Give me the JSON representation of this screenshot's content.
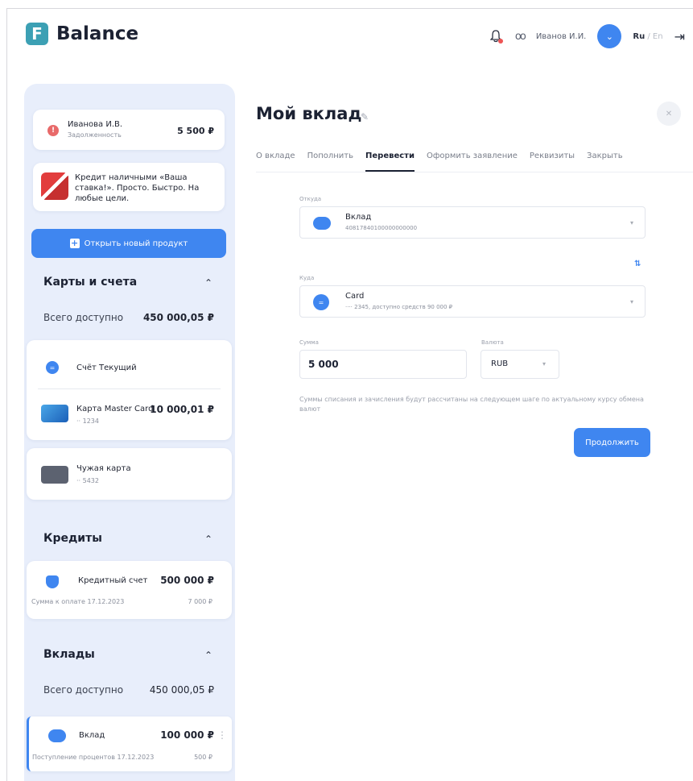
{
  "header": {
    "logo_letter": "F",
    "logo_text": "Balance",
    "user_name": "Иванов И.И.",
    "lang_active": "Ru",
    "lang_sep_other": " / En"
  },
  "sidebar": {
    "debt": {
      "name": "Иванова И.В.",
      "subtitle": "Задолженность",
      "amount": "5 500 ₽"
    },
    "promo": {
      "text": "Кредит наличными «Ваша ставка!». Просто. Быстро. На любые цели."
    },
    "open_product_label": "Открыть новый продукт",
    "cards_section": {
      "title": "Карты и счета",
      "total_label": "Всего доступно",
      "total_value": "450 000,05 ₽",
      "account_name": "Счёт Текущий",
      "master_card": {
        "name": "Карта Master Card",
        "number": "·· 1234",
        "amount": "10 000,01 ₽"
      },
      "foreign_card": {
        "name": "Чужая карта",
        "number": "·· 5432"
      }
    },
    "credits_section": {
      "title": "Кредиты",
      "item": {
        "name": "Кредитный счет",
        "amount": "500 000 ₽",
        "due_label": "Сумма к оплате 17.12.2023",
        "due_amount": "7 000 ₽"
      }
    },
    "deposits_section": {
      "title": "Вклады",
      "total_label": "Всего доступно",
      "total_value": "450 000,05 ₽",
      "item": {
        "name": "Вклад",
        "amount": "100 000 ₽",
        "interest_label": "Поступление процентов 17.12.2023",
        "interest_amount": "500 ₽"
      }
    }
  },
  "main": {
    "title": "Мой вклад",
    "tabs": [
      "О вкладе",
      "Пополнить",
      "Перевести",
      "Оформить заявление",
      "Реквизиты",
      "Закрыть"
    ],
    "active_tab": "Перевести",
    "from": {
      "label": "Откуда",
      "title": "Вклад",
      "subtitle": "40817840100000000000"
    },
    "to": {
      "label": "Куда",
      "title": "Card",
      "subtitle": "···· 2345, доступно средств 90 000 ₽"
    },
    "amount": {
      "label": "Сумма",
      "value": "5 000"
    },
    "currency": {
      "label": "Валюта",
      "value": "RUB"
    },
    "note": "Суммы списания и зачисления будут рассчитаны на следующем шаге по актуальному курсу обмена валют",
    "continue_label": "Продолжить"
  }
}
